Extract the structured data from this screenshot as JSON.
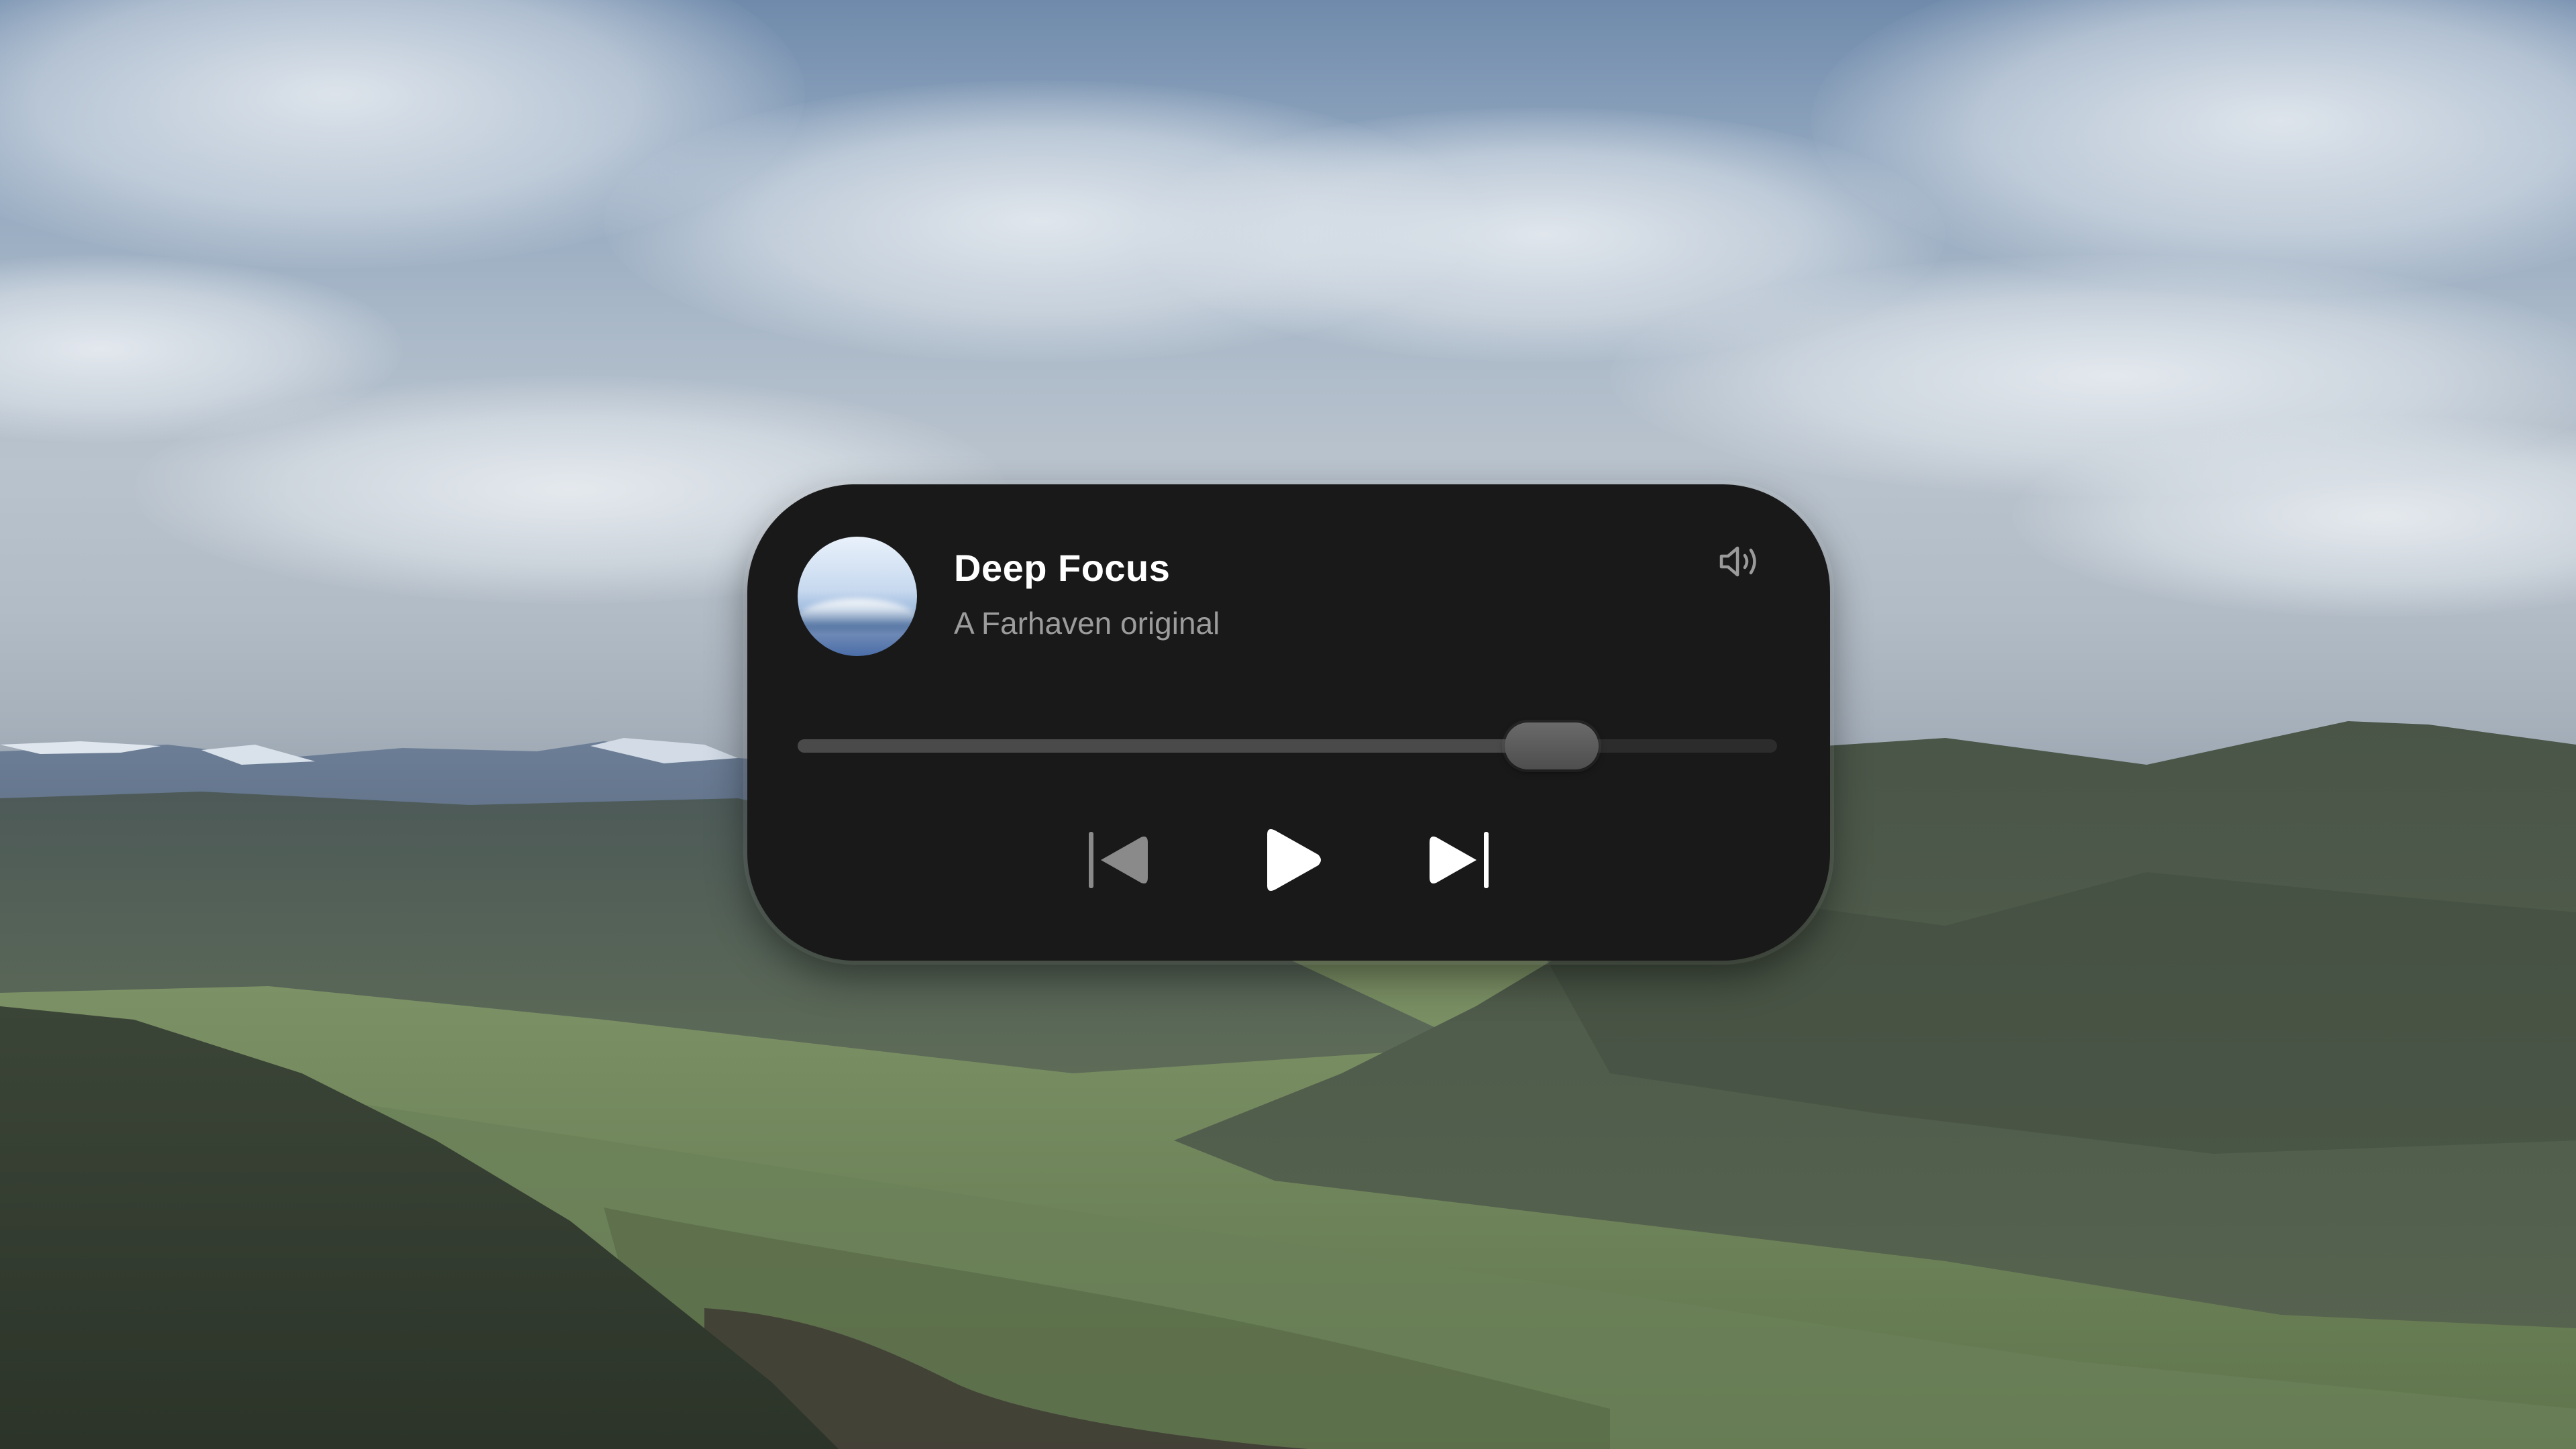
{
  "now_playing": {
    "title": "Deep Focus",
    "subtitle": "A Farhaven original",
    "artwork": "mountain-sky-artwork",
    "progress_fraction": 0.77
  },
  "controls": {
    "volume_icon": "speaker-volume-icon",
    "previous_icon": "skip-previous-icon",
    "play_icon": "play-icon",
    "next_icon": "skip-next-icon"
  },
  "colors": {
    "card_background": "#191919",
    "title_text": "#ffffff",
    "subtitle_text": "#9c9c9c",
    "icon_active": "#ffffff",
    "icon_disabled": "#8a8a8a"
  },
  "wallpaper": "mountain-valley-landscape"
}
